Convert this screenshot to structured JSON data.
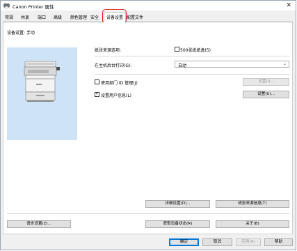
{
  "window": {
    "title": "Canon Printer 属性",
    "close_glyph": "✕"
  },
  "tabs": [
    {
      "label": "常规"
    },
    {
      "label": "共享"
    },
    {
      "label": "端口"
    },
    {
      "label": "高级"
    },
    {
      "label": "颜色管理"
    },
    {
      "label": "安全"
    },
    {
      "label": "设备设置",
      "active": true
    },
    {
      "label": "配置文件"
    }
  ],
  "device_settings": {
    "header": "设备设置: 手动",
    "paper_source_label": "纸张来源选项:",
    "paper_source_checkbox": {
      "label": "500张纸纸盒(5)",
      "checked": false
    },
    "print_on_host_label": "在主机后台打印(G):",
    "print_on_host_value": "自动",
    "department_id": {
      "label": "使用部门 ID 管理(J)",
      "checked": false
    },
    "department_id_button": "设置(I)...",
    "user_info": {
      "label": "设置用户信息(L)",
      "checked": true
    },
    "user_info_button": "设置(U)...",
    "details_button": "详细设置(D)...",
    "paper_source_info_button": "纸张来源信息(T)",
    "language_button": "语言设置(Z)...",
    "get_device_status_button": "获取设备状态(R)",
    "about_button": "关于(B)"
  },
  "footer": {
    "ok": "确定",
    "cancel": "取消",
    "apply": "应用(A)",
    "help": "帮助"
  },
  "colors": {
    "highlight_ring": "#e01e1e",
    "image_bg": "#cfe3f7",
    "default_button_border": "#0078d7"
  },
  "icons": [
    "printer-title-icon",
    "close-icon",
    "printer-device-image",
    "dropdown-chevron-icon"
  ]
}
